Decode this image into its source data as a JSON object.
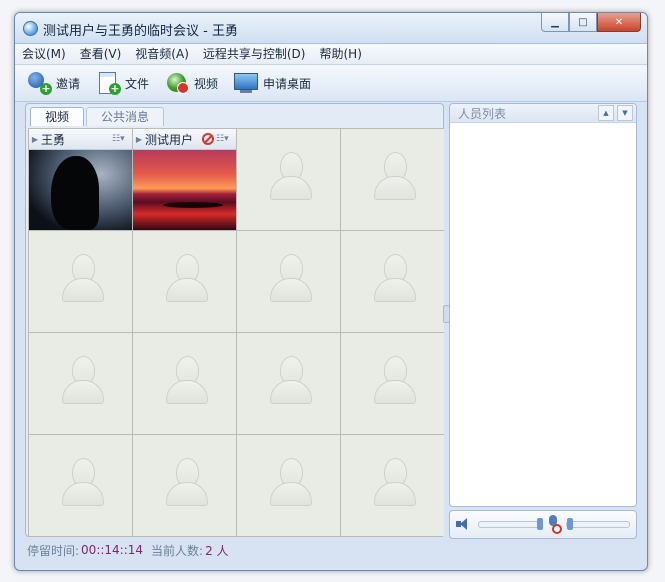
{
  "window": {
    "title": "测试用户与王勇的临时会议 - 王勇"
  },
  "menu": [
    "会议(M)",
    "查看(V)",
    "视音频(A)",
    "远程共享与控制(D)",
    "帮助(H)"
  ],
  "toolbar": {
    "invite": "邀请",
    "file": "文件",
    "video": "视频",
    "desktop": "申请桌面"
  },
  "tabs": {
    "video": "视频",
    "messages": "公共消息"
  },
  "videos": {
    "user1": "王勇",
    "user2": "测试用户"
  },
  "people": {
    "title": "人员列表"
  },
  "status": {
    "stay_label": "停留时间:",
    "stay_value": "00::14::14",
    "count_label": "当前人数:",
    "count_value": "2 人"
  }
}
